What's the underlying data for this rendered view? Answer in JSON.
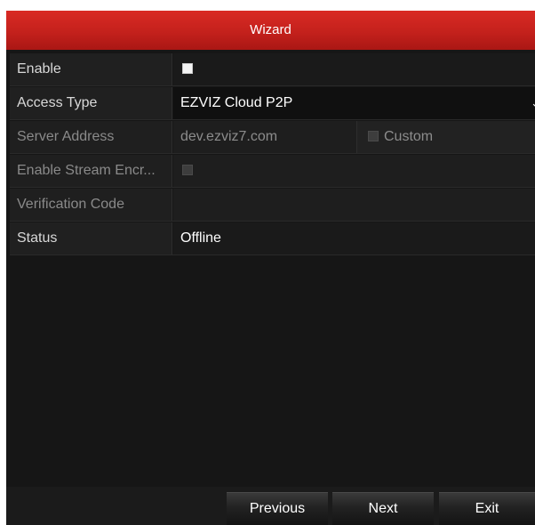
{
  "window": {
    "title": "Wizard"
  },
  "form": {
    "enable": {
      "label": "Enable",
      "checked": false
    },
    "access_type": {
      "label": "Access Type",
      "value": "EZVIZ Cloud P2P",
      "icon": "chevron-down-icon"
    },
    "server_address": {
      "label": "Server Address",
      "value": "dev.ezviz7.com",
      "custom_label": "Custom",
      "custom_checked": false
    },
    "stream_encryption": {
      "label": "Enable Stream Encr...",
      "checked": false
    },
    "verification_code": {
      "label": "Verification Code",
      "value": ""
    },
    "status": {
      "label": "Status",
      "value": "Offline"
    }
  },
  "footer": {
    "previous_label": "Previous",
    "next_label": "Next",
    "exit_label": "Exit"
  },
  "colors": {
    "title_bar": "#c4211c",
    "background": "#161616",
    "text": "#ffffff",
    "disabled_text": "#8c8c8c"
  }
}
